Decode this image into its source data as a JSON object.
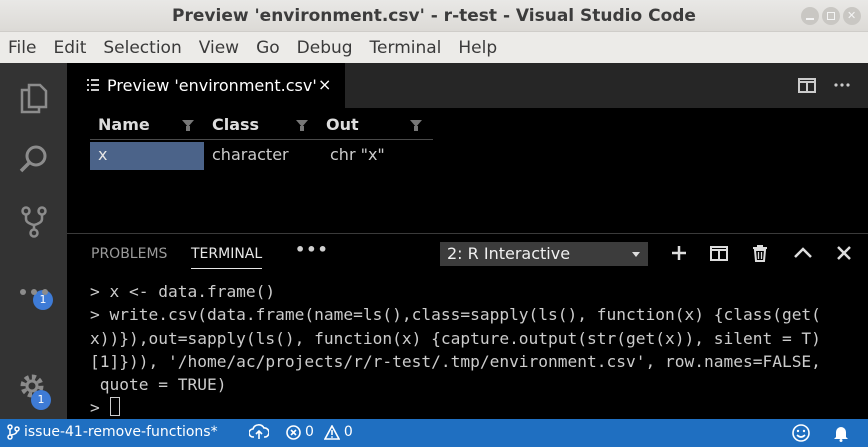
{
  "window": {
    "title": "Preview 'environment.csv' - r-test - Visual Studio Code"
  },
  "menu": [
    "File",
    "Edit",
    "Selection",
    "View",
    "Go",
    "Debug",
    "Terminal",
    "Help"
  ],
  "activity_bar": {
    "items": [
      {
        "icon": "files-icon"
      },
      {
        "icon": "search-icon"
      },
      {
        "icon": "source-control-icon",
        "badge": "1"
      },
      {
        "icon": "more-icon"
      }
    ],
    "settings": {
      "icon": "gear-icon",
      "badge": "1"
    }
  },
  "editor": {
    "tab": {
      "title": "Preview 'environment.csv'",
      "close": "×"
    },
    "table": {
      "columns": [
        "Name",
        "Class",
        "Out"
      ],
      "rows": [
        [
          "x",
          "character",
          "chr \"x\""
        ]
      ]
    }
  },
  "panel": {
    "tabs": [
      {
        "label": "PROBLEMS",
        "active": false
      },
      {
        "label": "TERMINAL",
        "active": true
      }
    ],
    "more": "•••",
    "terminal_select": "2: R Interactive",
    "terminal_lines": [
      "> x <- data.frame()",
      "> write.csv(data.frame(name=ls(),class=sapply(ls(), function(x) {class(get(",
      "x))}),out=sapply(ls(), function(x) {capture.output(str(get(x)), silent = T)",
      "[1]})), '/home/ac/projects/r/r-test/.tmp/environment.csv', row.names=FALSE,",
      " quote = TRUE)",
      "> "
    ]
  },
  "status": {
    "branch": "issue-41-remove-functions*",
    "errors": "0",
    "warnings": "0"
  },
  "colors": {
    "status_bar": "#1f6fc1",
    "badge": "#3e7bd6",
    "selection": "#4b6389"
  }
}
